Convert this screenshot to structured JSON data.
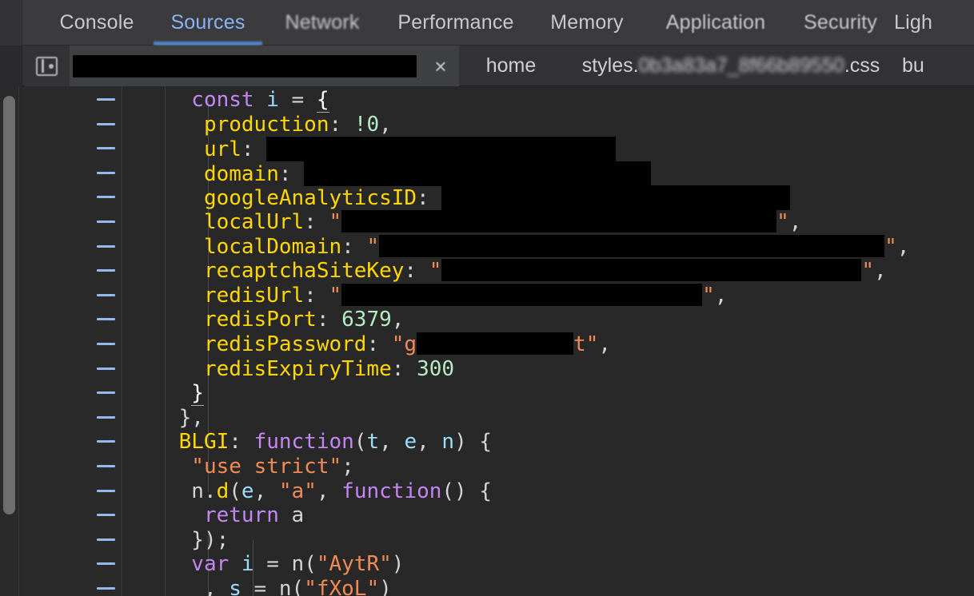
{
  "window": {
    "app": "Chrome DevTools",
    "theme_background": "#202124",
    "editor_background": "#282828",
    "accent_color": "#8ab4f8"
  },
  "panel_tabs": {
    "active": "Sources",
    "items": [
      {
        "label": "Console",
        "active": false
      },
      {
        "label": "Sources",
        "active": true
      },
      {
        "label": "Network",
        "active": false
      },
      {
        "label": "Performance",
        "active": false
      },
      {
        "label": "Memory",
        "active": false
      },
      {
        "label": "Application",
        "active": false
      },
      {
        "label": "Security",
        "active": false
      },
      {
        "label": "Ligh",
        "active": false
      }
    ]
  },
  "file_tabs": {
    "navigator_toggle_icon": "sidebar-panel-icon",
    "close_icon": "×",
    "items": [
      {
        "label": "",
        "redacted": true,
        "active": true
      },
      {
        "label": "home",
        "redacted": false,
        "active": false
      },
      {
        "label": "styles.",
        "hash": "0b3a83a7_8f66b89550",
        "suffix": ".css",
        "redacted": false,
        "active": false
      },
      {
        "label": "bu",
        "redacted": false,
        "active": false
      }
    ]
  },
  "editor": {
    "gutter_line_marker": "–",
    "gutter_line_count": 21,
    "scrollbar": {
      "visible": true
    },
    "code": [
      {
        "indent": 4,
        "text": "const i = {",
        "tokens": "const-decl"
      },
      {
        "indent": 6,
        "text": "production: !0,",
        "tokens": "prop-bool"
      },
      {
        "indent": 6,
        "text": "url: ███",
        "tokens": "prop-redacted"
      },
      {
        "indent": 6,
        "text": "domain: ███",
        "tokens": "prop-redacted"
      },
      {
        "indent": 6,
        "text": "googleAnalyticsID: ███",
        "tokens": "prop-redacted"
      },
      {
        "indent": 6,
        "text": "localUrl: \"███\",",
        "tokens": "prop-str-redacted"
      },
      {
        "indent": 6,
        "text": "localDomain: \"███\",",
        "tokens": "prop-str-redacted"
      },
      {
        "indent": 6,
        "text": "recaptchaSiteKey: \"███\",",
        "tokens": "prop-str-redacted"
      },
      {
        "indent": 6,
        "text": "redisUrl: \"███\",",
        "tokens": "prop-str-redacted"
      },
      {
        "indent": 6,
        "text": "redisPort: 6379,",
        "tokens": "prop-num"
      },
      {
        "indent": 6,
        "text": "redisPassword: \"g███t\",",
        "tokens": "prop-str-redacted"
      },
      {
        "indent": 6,
        "text": "redisExpiryTime: 300",
        "tokens": "prop-num"
      },
      {
        "indent": 4,
        "text": "}",
        "tokens": "brace"
      },
      {
        "indent": 2,
        "text": "},",
        "tokens": "brace"
      },
      {
        "indent": 2,
        "text": "BLGI: function(t, e, n) {",
        "tokens": "prop-fn"
      },
      {
        "indent": 4,
        "text": "\"use strict\";",
        "tokens": "string"
      },
      {
        "indent": 4,
        "text": "n.d(e, \"a\", function() {",
        "tokens": "call"
      },
      {
        "indent": 6,
        "text": "return a",
        "tokens": "return"
      },
      {
        "indent": 4,
        "text": "});",
        "tokens": "brace"
      },
      {
        "indent": 4,
        "text": "var i = n(\"AytR\")",
        "tokens": "var-decl"
      },
      {
        "indent": 6,
        "text": ", s = n(\"fXoL\")",
        "tokens": "var-decl"
      }
    ],
    "literals": {
      "production_value": "!0",
      "redis_port": "6379",
      "redis_expiry_time": "300",
      "use_strict": "use strict",
      "module_id_blgi": "BLGI",
      "export_name": "a",
      "require_aytr": "AytR",
      "require_fxol": "fXoL",
      "password_prefix": "g",
      "password_suffix": "t"
    },
    "syntax_colors": {
      "keyword": "#c586f5",
      "identifier": "#9cdcfe",
      "property": "#ffd700",
      "string": "#f28b54",
      "number": "#b5ecc4",
      "punctuation": "#d4d4d4",
      "gutter_dash": "#96b8f0"
    }
  }
}
